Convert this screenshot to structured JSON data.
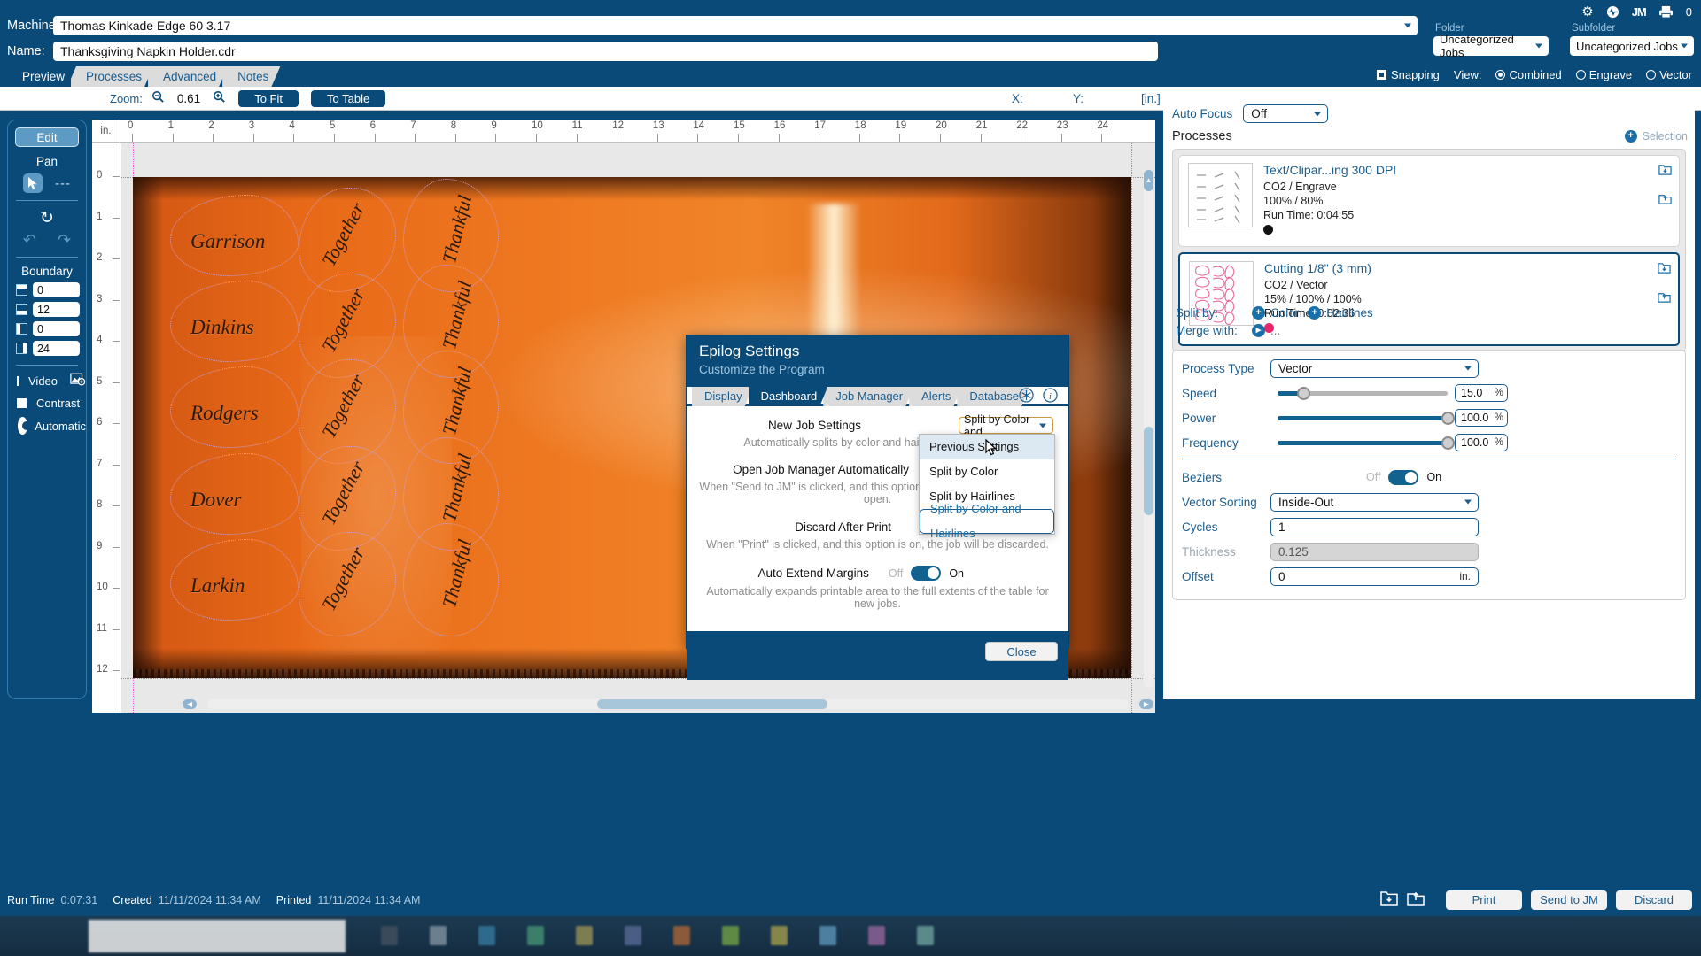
{
  "header": {
    "machine_label": "Machine:",
    "machine_value": "Thomas Kinkade Edge 60 3.17",
    "name_label": "Name:",
    "name_value": "Thanksgiving Napkin Holder.cdr",
    "folder_label": "Folder",
    "folder_value": "Uncategorized Jobs",
    "subfolder_label": "Subfolder",
    "subfolder_value": "Uncategorized Jobs",
    "icons": [
      "gear-icon",
      "pulse-icon",
      "jm-icon",
      "printer-icon"
    ],
    "jm_text": "JM",
    "print_queue_count": "0"
  },
  "tabs": [
    {
      "label": "Preview",
      "active": true
    },
    {
      "label": "Processes",
      "active": false
    },
    {
      "label": "Advanced",
      "active": false
    },
    {
      "label": "Notes",
      "active": false
    }
  ],
  "view_controls": {
    "snapping_label": "Snapping",
    "snapping_checked": true,
    "view_label": "View:",
    "options": [
      {
        "label": "Combined",
        "selected": true
      },
      {
        "label": "Engrave",
        "selected": false
      },
      {
        "label": "Vector",
        "selected": false
      }
    ]
  },
  "zoombar": {
    "zoom_label": "Zoom:",
    "zoom_value": "0.61",
    "to_fit": "To Fit",
    "to_table": "To Table",
    "x_label": "X:",
    "y_label": "Y:",
    "units": "[in.]"
  },
  "left_panel": {
    "edit_label": "Edit",
    "pan_label": "Pan",
    "dashes": "---",
    "boundary_title": "Boundary",
    "boundary": [
      {
        "icon": "boundary-top-icon",
        "value": "0"
      },
      {
        "icon": "boundary-bottom-icon",
        "value": "12"
      },
      {
        "icon": "boundary-left-icon",
        "value": "0"
      },
      {
        "icon": "boundary-right-icon",
        "value": "24"
      }
    ],
    "video_label": "Video",
    "video_checked": false,
    "contrast_label": "Contrast",
    "contrast_checked": false,
    "automatic_label": "Automatic"
  },
  "ruler": {
    "unit_label": "in.",
    "h_ticks": [
      "0",
      "1",
      "2",
      "3",
      "4",
      "5",
      "6",
      "7",
      "8",
      "9",
      "10",
      "11",
      "12",
      "13",
      "14",
      "15",
      "16",
      "17",
      "18",
      "19",
      "20",
      "21",
      "22",
      "23",
      "24"
    ],
    "v_ticks": [
      "0",
      "1",
      "2",
      "3",
      "4",
      "5",
      "6",
      "7",
      "8",
      "9",
      "10",
      "11",
      "12"
    ]
  },
  "artwork": {
    "names": [
      "Garrison",
      "Dinkins",
      "Rodgers",
      "Dover",
      "Larkin"
    ],
    "together_text": "Together",
    "thankful_text": "Thankful"
  },
  "right_panel": {
    "auto_focus_label": "Auto Focus",
    "auto_focus_value": "Off",
    "processes_label": "Processes",
    "selection_label": "Selection",
    "processes": [
      {
        "name": "Text/Clipar...ing 300 DPI",
        "mode": "CO2 / Engrave",
        "values": "100% / 80%",
        "run_time": "Run Time: 0:04:55",
        "color": "#111111",
        "selected": false,
        "thumb": "engrave-thumb"
      },
      {
        "name": "Cutting 1/8\" (3 mm)",
        "mode": "CO2 / Vector",
        "values": "15% / 100% / 100%",
        "run_time": "Run Time: 0:02:36",
        "color": "#e8266b",
        "selected": true,
        "thumb": "vector-thumb"
      }
    ],
    "split_by_label": "Split by:",
    "split_color_label": "Color",
    "split_hairlines_label": "Hairlines",
    "merge_with_label": "Merge with:",
    "merge_with_value": "...",
    "settings": {
      "process_type_label": "Process Type",
      "process_type_value": "Vector",
      "speed_label": "Speed",
      "speed_value": "15.0",
      "speed_unit": "%",
      "speed_pct": 15,
      "power_label": "Power",
      "power_value": "100.0",
      "power_unit": "%",
      "power_pct": 100,
      "frequency_label": "Frequency",
      "frequency_value": "100.0",
      "frequency_unit": "%",
      "frequency_pct": 100,
      "beziers_label": "Beziers",
      "beziers_off": "Off",
      "beziers_on": "On",
      "beziers_value": true,
      "vector_sorting_label": "Vector Sorting",
      "vector_sorting_value": "Inside-Out",
      "cycles_label": "Cycles",
      "cycles_value": "1",
      "thickness_label": "Thickness",
      "thickness_value": "0.125",
      "offset_label": "Offset",
      "offset_value": "0",
      "offset_unit": "in."
    }
  },
  "dialog": {
    "title": "Epilog Settings",
    "subtitle": "Customize the Program",
    "tabs": [
      {
        "label": "Display",
        "active": false
      },
      {
        "label": "Dashboard",
        "active": true
      },
      {
        "label": "Job Manager",
        "active": false
      },
      {
        "label": "Alerts",
        "active": false
      },
      {
        "label": "Database",
        "active": false
      }
    ],
    "tab_icons": [
      "asterisk-icon",
      "info-icon"
    ],
    "rows": [
      {
        "label": "New Job Settings",
        "description": "Automatically splits by color and hairlines for new jobs."
      },
      {
        "label": "Open Job Manager Automatically",
        "description": "When \"Send to JM\" is clicked, and this option is on, the Job Manager will open."
      },
      {
        "label": "Discard After Print",
        "description": "When \"Print\" is clicked, and this option is on, the job will be discarded."
      },
      {
        "label": "Auto Extend Margins",
        "description": "Automatically expands printable area to the full extents of the table for new jobs."
      }
    ],
    "new_job_settings_value": "Split by Color and ...",
    "dropdown_options": [
      {
        "label": "Previous Settings",
        "hovered": true,
        "selected": false
      },
      {
        "label": "Split by Color",
        "hovered": false,
        "selected": false
      },
      {
        "label": "Split by Hairlines",
        "hovered": false,
        "selected": false
      },
      {
        "label": "Split by Color and Hairlines",
        "hovered": false,
        "selected": true
      }
    ],
    "auto_extend_off": "Off",
    "auto_extend_on": "On",
    "auto_extend_value": true,
    "close_label": "Close"
  },
  "statusbar": {
    "run_time_key": "Run Time",
    "run_time_value": "0:07:31",
    "created_key": "Created",
    "created_value": "11/11/2024 11:34 AM",
    "printed_key": "Printed",
    "printed_value": "11/11/2024 11:34 AM",
    "buttons": [
      {
        "label": "Print"
      },
      {
        "label": "Send to JM"
      },
      {
        "label": "Discard"
      }
    ]
  },
  "colors": {
    "brand_blue": "#0a4a78",
    "accent_blue": "#1a6fa8",
    "vector_pink": "#e8266b",
    "guide_magenta": "#e060d8"
  }
}
